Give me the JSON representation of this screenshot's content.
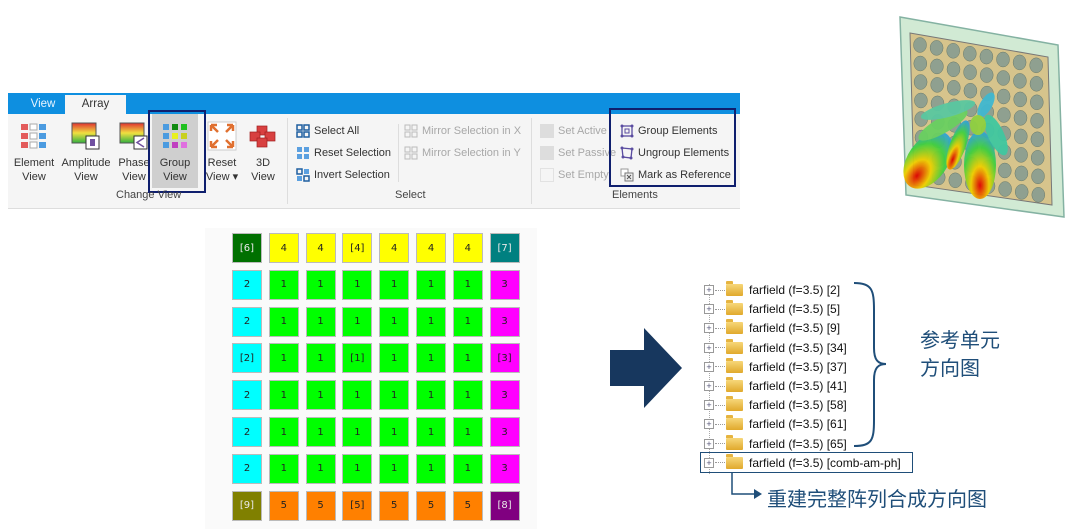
{
  "ribbon": {
    "tabs": [
      {
        "label": "View"
      },
      {
        "label": "Array",
        "active": true
      }
    ],
    "change_view": {
      "label": "Change View",
      "buttons": [
        {
          "line1": "Element",
          "line2": "View",
          "icon": "element-grid-icon"
        },
        {
          "line1": "Amplitude",
          "line2": "View",
          "icon": "amplitude-map-icon"
        },
        {
          "line1": "Phase",
          "line2": "View",
          "icon": "phase-map-icon"
        },
        {
          "line1": "Group",
          "line2": "View",
          "icon": "group-grid-icon",
          "active": true
        },
        {
          "line1": "Reset",
          "line2": "View ▾",
          "icon": "expand-arrows-icon"
        },
        {
          "line1": "3D",
          "line2": "View",
          "icon": "cubes-3d-icon"
        }
      ]
    },
    "select": {
      "label": "Select",
      "items": [
        {
          "label": "Select All"
        },
        {
          "label": "Reset Selection"
        },
        {
          "label": "Invert Selection"
        }
      ],
      "mirror": [
        {
          "label": "Mirror Selection in X",
          "disabled": true
        },
        {
          "label": "Mirror Selection in Y",
          "disabled": true
        }
      ]
    },
    "elements": {
      "label": "Elements",
      "set": [
        {
          "label": "Set Active",
          "disabled": true
        },
        {
          "label": "Set Passive",
          "disabled": true
        },
        {
          "label": "Set Empty",
          "disabled": true
        }
      ],
      "items": [
        {
          "label": "Group Elements"
        },
        {
          "label": "Ungroup Elements"
        },
        {
          "label": "Mark as Reference"
        }
      ]
    }
  },
  "group_grid": {
    "colors": {
      "1": "#00ff00",
      "2": "#00ffff",
      "3": "#ff00ff",
      "4": "#ffff00",
      "5": "#ff8000",
      "6": "#007000",
      "7": "#008080",
      "8": "#800080",
      "9": "#808000"
    },
    "rows": [
      [
        "[6]",
        "4",
        "4",
        "[4]",
        "4",
        "4",
        "4",
        "[7]"
      ],
      [
        "2",
        "1",
        "1",
        "1",
        "1",
        "1",
        "1",
        "3"
      ],
      [
        "2",
        "1",
        "1",
        "1",
        "1",
        "1",
        "1",
        "3"
      ],
      [
        "[2]",
        "1",
        "1",
        "[1]",
        "1",
        "1",
        "1",
        "[3]"
      ],
      [
        "2",
        "1",
        "1",
        "1",
        "1",
        "1",
        "1",
        "3"
      ],
      [
        "2",
        "1",
        "1",
        "1",
        "1",
        "1",
        "1",
        "3"
      ],
      [
        "2",
        "1",
        "1",
        "1",
        "1",
        "1",
        "1",
        "3"
      ],
      [
        "[9]",
        "5",
        "5",
        "[5]",
        "5",
        "5",
        "5",
        "[8]"
      ]
    ]
  },
  "arrow_color": "#17375e",
  "tree": {
    "items": [
      {
        "label": "farfield (f=3.5) [2]"
      },
      {
        "label": "farfield (f=3.5) [5]"
      },
      {
        "label": "farfield (f=3.5) [9]"
      },
      {
        "label": "farfield (f=3.5) [34]"
      },
      {
        "label": "farfield (f=3.5) [37]"
      },
      {
        "label": "farfield (f=3.5) [41]"
      },
      {
        "label": "farfield (f=3.5) [58]"
      },
      {
        "label": "farfield (f=3.5) [61]"
      },
      {
        "label": "farfield (f=3.5) [65]"
      },
      {
        "label": "farfield (f=3.5) [comb-am-ph]",
        "highlighted": true
      }
    ]
  },
  "annotations": {
    "reference_line1": "参考单元",
    "reference_line2": "方向图",
    "combined": "重建完整阵列合成方向图"
  }
}
